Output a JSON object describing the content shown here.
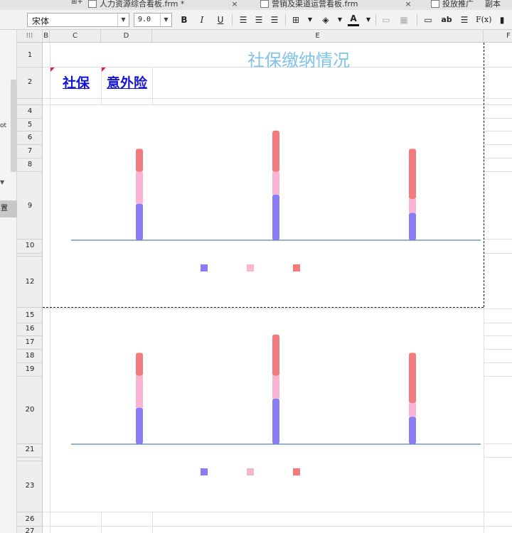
{
  "tabs": [
    {
      "label": "人力资源综合看板.frm *",
      "close": "×"
    },
    {
      "label": "营销及渠道运营看板.frm",
      "close": "×"
    },
    {
      "label": "投放推广",
      "close": ""
    },
    {
      "label": "副本",
      "close": ""
    }
  ],
  "tab_add_label": "⊞+",
  "toolbar": {
    "font_name": "宋体",
    "font_size": "9.0",
    "bold": "B",
    "italic": "I",
    "underline": "U",
    "fx_label": "F(x)",
    "ab_label": "ab"
  },
  "sidebar": {
    "fragment_text": "ot",
    "active_text": "置"
  },
  "columns": [
    "B",
    "C",
    "D",
    "E",
    "F"
  ],
  "rows": [
    "1",
    "2",
    "4",
    "5",
    "6",
    "7",
    "8",
    "9",
    "10",
    "12",
    "15",
    "16",
    "17",
    "18",
    "19",
    "20",
    "21",
    "23",
    "26",
    "27"
  ],
  "sheet": {
    "title": "社保缴纳情况",
    "links": [
      "社保",
      "意外险"
    ]
  },
  "colors": {
    "series": [
      "#8a7cf5",
      "#f9b4d4",
      "#f27b7b"
    ],
    "title": "#7ec2e6",
    "link": "#1414d8",
    "axis": "#2e6a80"
  },
  "chart_data": [
    {
      "type": "bar",
      "stacked": true,
      "categories": [
        "",
        "",
        ""
      ],
      "y_ticks": [
        "",
        "",
        "",
        "",
        "",
        "",
        "",
        ""
      ],
      "ylim": [
        0,
        140
      ],
      "series": [
        {
          "values": [
            40,
            50,
            30
          ]
        },
        {
          "values": [
            35,
            25,
            15
          ]
        },
        {
          "values": [
            25,
            45,
            55
          ]
        }
      ],
      "legend": [
        "",
        "",
        ""
      ],
      "legend_position": "bottom"
    },
    {
      "type": "bar",
      "stacked": true,
      "categories": [
        "",
        "",
        ""
      ],
      "y_ticks": [
        "",
        "",
        "",
        "",
        "",
        "",
        "",
        ""
      ],
      "ylim": [
        0,
        140
      ],
      "series": [
        {
          "values": [
            40,
            50,
            30
          ]
        },
        {
          "values": [
            35,
            25,
            15
          ]
        },
        {
          "values": [
            25,
            45,
            55
          ]
        }
      ],
      "legend": [
        "",
        "",
        ""
      ],
      "legend_position": "bottom"
    }
  ]
}
